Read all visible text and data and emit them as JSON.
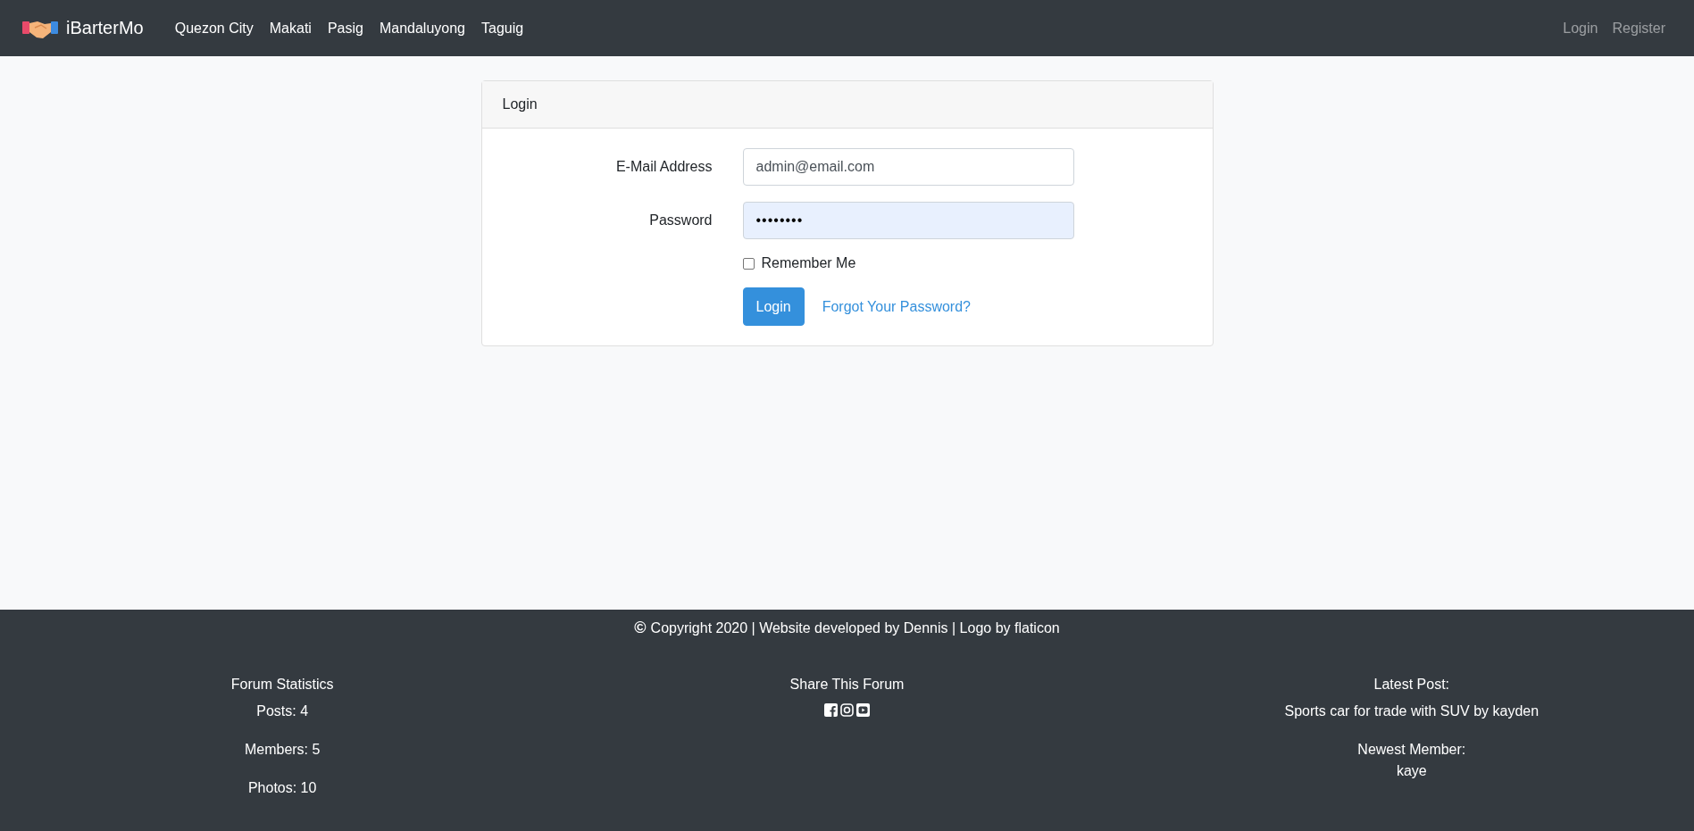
{
  "navbar": {
    "brand": "iBarterMo",
    "links": [
      {
        "label": "Quezon City"
      },
      {
        "label": "Makati"
      },
      {
        "label": "Pasig"
      },
      {
        "label": "Mandaluyong"
      },
      {
        "label": "Taguig"
      }
    ],
    "auth_links": [
      {
        "label": "Login"
      },
      {
        "label": "Register"
      }
    ]
  },
  "login_card": {
    "title": "Login",
    "fields": [
      {
        "label": "E-Mail Address",
        "value": "admin@email.com",
        "autofilled": false
      },
      {
        "label": "Password",
        "value": "••••••••",
        "autofilled": true
      }
    ],
    "remember": {
      "label": "Remember Me",
      "checked": false
    },
    "submit": "Login",
    "forgot_link": "Forgot Your Password?"
  },
  "footer": {
    "copyright_symbol": "©",
    "copyright": "Copyright 2020 | Website developed by Dennis | Logo by flaticon",
    "stats": {
      "title": "Forum Statistics",
      "lines": [
        "Posts: 4",
        "Members: 5",
        "Photos: 10"
      ]
    },
    "share": {
      "title": "Share This Forum"
    },
    "latest": {
      "title": "Latest Post:",
      "post": "Sports car for trade with SUV by kayden",
      "newest_title": "Newest Member:",
      "newest": "kaye"
    }
  }
}
